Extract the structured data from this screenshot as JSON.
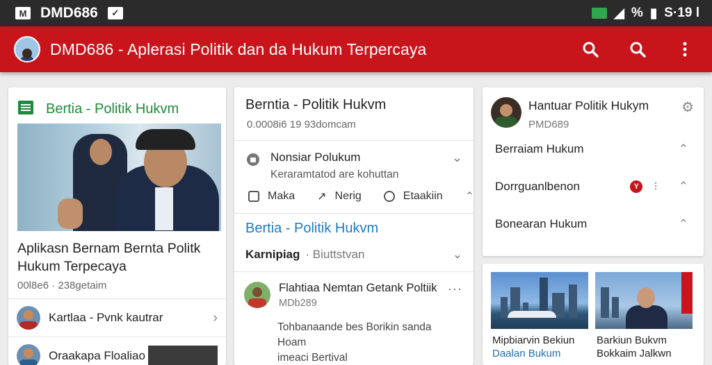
{
  "status_bar": {
    "app_name": "DMD686",
    "right_text": "S·19 l",
    "battery_text": "%"
  },
  "app_bar": {
    "title": "DMD686 - Aplerasi Politik  dan da Hukum Terpercaya"
  },
  "card1": {
    "header": "Bertia  -  Politik Hukvm",
    "caption": "Aplikasn Bernam Bernta Politk Hukum Terpecaya",
    "meta": "00l8e6 · 238getaim",
    "row1": "Kartlaa - Pvnk kautrar",
    "row2": "Oraakapa Floaliao"
  },
  "card2": {
    "title": "Berntia - Politik Hukvm",
    "meta": "0.0008i6 19 93domcam",
    "item_title": "Nonsiar Polukum",
    "item_sub": "Keraramtatod are kohuttan",
    "actions": [
      "Maka",
      "Nerig",
      "Etaakiin"
    ],
    "section": "Bertia - Politik Hukvm",
    "row_bold": "Karnipiag",
    "row_sub": "· Biuttstvan",
    "feed_title": "Flahtiaa Nemtan Getank Poltiik",
    "feed_meta": "MDb289",
    "feed_body": [
      "Tohbanaande bes Borikin sanda Hoam",
      "imeaci Bertival"
    ]
  },
  "card3": {
    "title": "Hantuar Politik Hukym",
    "subtitle": "PMD689",
    "rows": [
      "Berraiam Hukum",
      "Dorrguanlbenon",
      "Bonearan Hukum"
    ],
    "badge": "Y"
  },
  "card4": {
    "captions": [
      "Mipbiarvin Bekiun",
      "Barkiun Bukvm"
    ],
    "captions2": [
      "Daalan Bukum",
      "Bokkaim Jalkwn"
    ]
  }
}
